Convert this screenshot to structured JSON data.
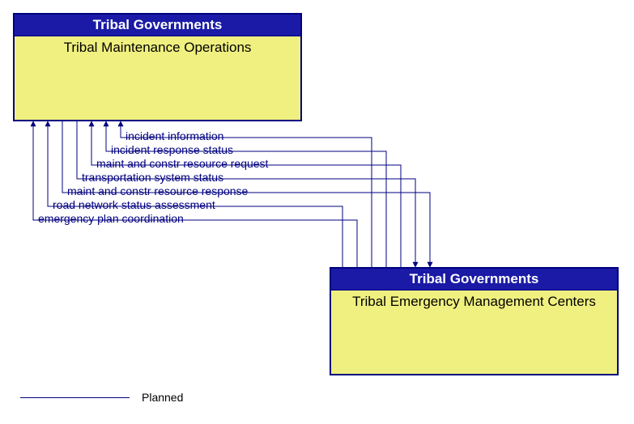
{
  "nodes": {
    "top": {
      "header": "Tribal Governments",
      "body": "Tribal Maintenance Operations"
    },
    "bottom": {
      "header": "Tribal Governments",
      "body": "Tribal Emergency Management Centers"
    }
  },
  "flows": {
    "f1": "incident information",
    "f2": "incident response status",
    "f3": "maint and constr resource request",
    "f4": "transportation system status",
    "f5": "maint and constr resource response",
    "f6": "road network status assessment",
    "f7": "emergency plan coordination"
  },
  "legend": {
    "planned": "Planned"
  }
}
